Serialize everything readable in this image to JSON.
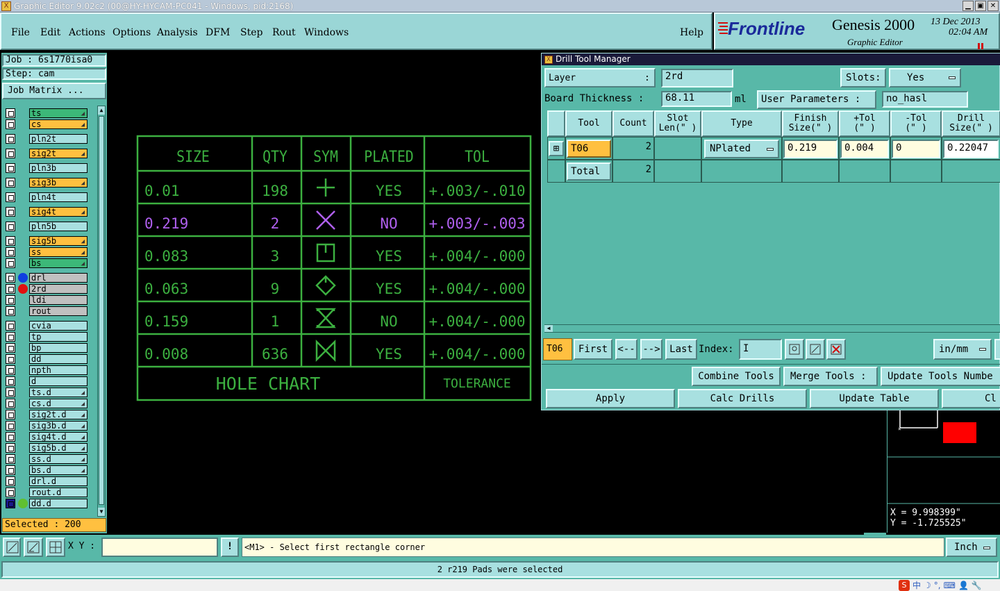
{
  "window": {
    "title": "Graphic Editor 9.02c2 (00@HY-HYCAM-PC041 - Windows, pid:2168)",
    "app_icon": "X"
  },
  "menu": [
    "File",
    "Edit",
    "Actions",
    "Options",
    "Analysis",
    "DFM",
    "Step",
    "Rout",
    "Windows"
  ],
  "menu_help": "Help",
  "brand": {
    "logo": "Frontline",
    "product": "Genesis 2000",
    "subtitle": "Graphic Editor",
    "date": "13 Dec 2013",
    "time": "02:04 AM"
  },
  "sidebar": {
    "job": "Job : 6s1770isa0",
    "step": "Step: cam",
    "job_matrix": "Job Matrix ...",
    "selected": "Selected : 200",
    "layers": [
      {
        "name": "ts",
        "color": "#3cb878",
        "arrow": true
      },
      {
        "name": "cs",
        "color": "#ffc040",
        "arrow": true
      },
      {
        "name": "pln2t",
        "color": "#a8e0e0",
        "arrow": false
      },
      {
        "name": "sig2t",
        "color": "#ffc040",
        "arrow": true
      },
      {
        "name": "pln3b",
        "color": "#a8e0e0",
        "arrow": false
      },
      {
        "name": "sig3b",
        "color": "#ffc040",
        "arrow": true
      },
      {
        "name": "pln4t",
        "color": "#a8e0e0",
        "arrow": false
      },
      {
        "name": "sig4t",
        "color": "#ffc040",
        "arrow": true
      },
      {
        "name": "pln5b",
        "color": "#a8e0e0",
        "arrow": false
      },
      {
        "name": "sig5b",
        "color": "#ffc040",
        "arrow": true
      },
      {
        "name": "ss",
        "color": "#ffc040",
        "arrow": true
      },
      {
        "name": "bs",
        "color": "#3cb878",
        "arrow": true
      },
      {
        "name": "drl",
        "color": "#c0c0c0",
        "arrow": false,
        "dot": "#1040e0"
      },
      {
        "name": "2rd",
        "color": "#c0c0c0",
        "arrow": false,
        "dot": "#e01010"
      },
      {
        "name": "ldi",
        "color": "#c0c0c0",
        "arrow": false
      },
      {
        "name": "rout",
        "color": "#c0c0c0",
        "arrow": false
      },
      {
        "name": "cvia",
        "color": "#a8e0e0",
        "arrow": false
      },
      {
        "name": "tp",
        "color": "#a8e0e0",
        "arrow": false
      },
      {
        "name": "bp",
        "color": "#a8e0e0",
        "arrow": false
      },
      {
        "name": "dd",
        "color": "#a8e0e0",
        "arrow": false
      },
      {
        "name": "npth",
        "color": "#a8e0e0",
        "arrow": false
      },
      {
        "name": "d",
        "color": "#a8e0e0",
        "arrow": false
      },
      {
        "name": "ts.d",
        "color": "#a8e0e0",
        "arrow": true
      },
      {
        "name": "cs.d",
        "color": "#a8e0e0",
        "arrow": true
      },
      {
        "name": "sig2t.d",
        "color": "#a8e0e0",
        "arrow": true
      },
      {
        "name": "sig3b.d",
        "color": "#a8e0e0",
        "arrow": true
      },
      {
        "name": "sig4t.d",
        "color": "#a8e0e0",
        "arrow": true
      },
      {
        "name": "sig5b.d",
        "color": "#a8e0e0",
        "arrow": true
      },
      {
        "name": "ss.d",
        "color": "#a8e0e0",
        "arrow": true
      },
      {
        "name": "bs.d",
        "color": "#a8e0e0",
        "arrow": true
      },
      {
        "name": "drl.d",
        "color": "#a8e0e0",
        "arrow": false
      },
      {
        "name": "rout.d",
        "color": "#a8e0e0",
        "arrow": false
      },
      {
        "name": "dd.d",
        "color": "#a8e0e0",
        "arrow": false
      }
    ]
  },
  "hole_chart": {
    "headers": [
      "SIZE",
      "QTY",
      "SYM",
      "PLATED",
      "TOL"
    ],
    "rows": [
      {
        "size": "0.01",
        "qty": "198",
        "sym": "plus",
        "plated": "YES",
        "tol": "+.003/-.010",
        "highlight": false
      },
      {
        "size": "0.219",
        "qty": "2",
        "sym": "x",
        "plated": "NO",
        "tol": "+.003/-.003",
        "highlight": true
      },
      {
        "size": "0.083",
        "qty": "3",
        "sym": "square-tick",
        "plated": "YES",
        "tol": "+.004/-.000",
        "highlight": false
      },
      {
        "size": "0.063",
        "qty": "9",
        "sym": "diamond",
        "plated": "YES",
        "tol": "+.004/-.000",
        "highlight": false
      },
      {
        "size": "0.159",
        "qty": "1",
        "sym": "hourglass",
        "plated": "NO",
        "tol": "+.004/-.000",
        "highlight": false
      },
      {
        "size": "0.008",
        "qty": "636",
        "sym": "bowtie",
        "plated": "YES",
        "tol": "+.004/-.000",
        "highlight": false
      }
    ],
    "footer_left": "HOLE CHART",
    "footer_right": "TOLERANCE"
  },
  "dtm": {
    "title": "Drill Tool Manager",
    "layer_label": "Layer",
    "layer_colon": ":",
    "layer_value": "2rd",
    "slots_label": "Slots:",
    "slots_value": "Yes",
    "thickness_label": "Board Thickness :",
    "thickness_value": "68.11",
    "thickness_unit": "ml",
    "user_params_label": "User Parameters :",
    "user_params_value": "no_hasl",
    "columns": [
      "Tool",
      "Count",
      "Slot\nLen(\" )",
      "Type",
      "Finish\nSize(\" )",
      "+Tol\n(\" )",
      "-Tol\n(\" )",
      "Drill\nSize(\" )"
    ],
    "row": {
      "tool": "T06",
      "count": "2",
      "type": "NPlated",
      "finish": "0.219",
      "ptol": "0.004",
      "ntol": "0",
      "drill": "0.22047"
    },
    "total_label": "Total",
    "total_count": "2",
    "current_tool": "T06",
    "nav": {
      "first": "First",
      "prev": "<--",
      "next": "-->",
      "last": "Last",
      "index_label": "Index:",
      "units": "in/mm"
    },
    "buttons": {
      "combine": "Combine Tools",
      "merge": "Merge Tools :",
      "update_numbers": "Update Tools Numbe",
      "apply": "Apply",
      "calc": "Calc Drills",
      "update_table": "Update Table",
      "close": "Cl"
    }
  },
  "coords": {
    "x": "X = 9.998399\"",
    "y": "Y = -1.725525\""
  },
  "status": {
    "xy_label": "X Y :",
    "xy_value": "",
    "prompt": "<M1> - Select first rectangle corner",
    "units": "Inch",
    "message": "2 r219 Pads were selected"
  },
  "tray": [
    "中",
    "☽",
    "°,",
    "⌨",
    "👤",
    "🔧"
  ]
}
